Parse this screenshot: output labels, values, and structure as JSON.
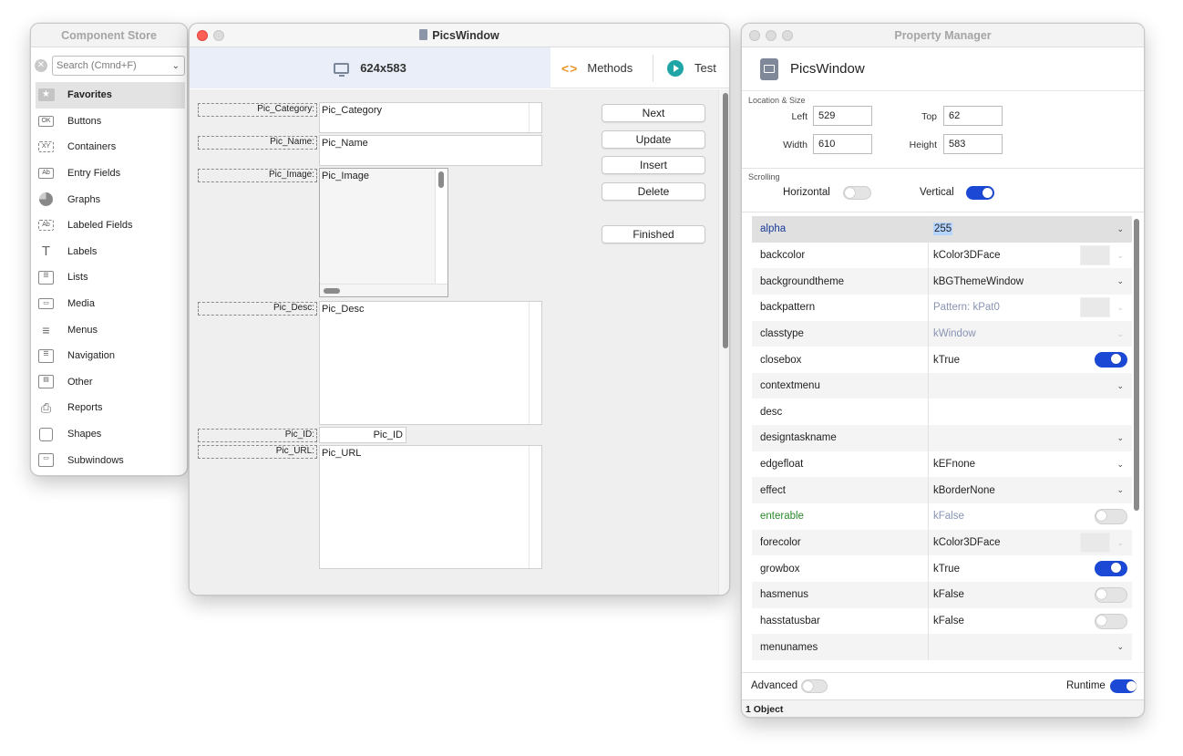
{
  "component_store": {
    "title": "Component Store",
    "search_placeholder": "Search (Cmnd+F)",
    "items": [
      {
        "label": "Favorites",
        "icon": "star-icon",
        "selected": true
      },
      {
        "label": "Buttons",
        "icon": "ok-button-icon"
      },
      {
        "label": "Containers",
        "icon": "xy-container-icon"
      },
      {
        "label": "Entry Fields",
        "icon": "entry-field-icon"
      },
      {
        "label": "Graphs",
        "icon": "pie-chart-icon"
      },
      {
        "label": "Labeled Fields",
        "icon": "labeled-field-icon"
      },
      {
        "label": "Labels",
        "icon": "text-t-icon"
      },
      {
        "label": "Lists",
        "icon": "list-icon"
      },
      {
        "label": "Media",
        "icon": "media-icon"
      },
      {
        "label": "Menus",
        "icon": "menu-icon"
      },
      {
        "label": "Navigation",
        "icon": "navigation-icon"
      },
      {
        "label": "Other",
        "icon": "other-icon"
      },
      {
        "label": "Reports",
        "icon": "printer-icon"
      },
      {
        "label": "Shapes",
        "icon": "shape-square-icon"
      },
      {
        "label": "Subwindows",
        "icon": "subwindow-icon"
      }
    ]
  },
  "pics_window": {
    "title": "PicsWindow",
    "size_label": "624x583",
    "methods_label": "Methods",
    "methods_icon": "<>",
    "test_label": "Test",
    "fields": {
      "pic_category_label": "Pic_Category:",
      "pic_category_value": "Pic_Category",
      "pic_name_label": "Pic_Name:",
      "pic_name_value": "Pic_Name",
      "pic_image_label": "Pic_Image:",
      "pic_image_value": "Pic_Image",
      "pic_desc_label": "Pic_Desc:",
      "pic_desc_value": "Pic_Desc",
      "pic_id_label": "Pic_ID:",
      "pic_id_value": "Pic_ID",
      "pic_url_label": "Pic_URL:",
      "pic_url_value": "Pic_URL"
    },
    "buttons": {
      "next": "Next",
      "update": "Update",
      "insert": "Insert",
      "delete": "Delete",
      "finished": "Finished"
    }
  },
  "property_manager": {
    "title": "Property Manager",
    "object_name": "PicsWindow",
    "location_size_label": "Location & Size",
    "left_label": "Left",
    "left_value": "529",
    "top_label": "Top",
    "top_value": "62",
    "width_label": "Width",
    "width_value": "610",
    "height_label": "Height",
    "height_value": "583",
    "scrolling_label": "Scrolling",
    "horizontal_label": "Horizontal",
    "horizontal_on": false,
    "vertical_label": "Vertical",
    "vertical_on": true,
    "properties": [
      {
        "name": "alpha",
        "value": "255",
        "control": "dropdown",
        "selected": true
      },
      {
        "name": "backcolor",
        "value": "kColor3DFace",
        "control": "color"
      },
      {
        "name": "backgroundtheme",
        "value": "kBGThemeWindow",
        "control": "dropdown"
      },
      {
        "name": "backpattern",
        "value": "Pattern: kPat0",
        "control": "color",
        "dim": true
      },
      {
        "name": "classtype",
        "value": "kWindow",
        "control": "dropdown-disabled",
        "dim": true
      },
      {
        "name": "closebox",
        "value": "kTrue",
        "control": "toggle",
        "on": true
      },
      {
        "name": "contextmenu",
        "value": "",
        "control": "dropdown"
      },
      {
        "name": "desc",
        "value": "",
        "control": "none"
      },
      {
        "name": "designtaskname",
        "value": "",
        "control": "dropdown"
      },
      {
        "name": "edgefloat",
        "value": "kEFnone",
        "control": "dropdown"
      },
      {
        "name": "effect",
        "value": "kBorderNone",
        "control": "dropdown"
      },
      {
        "name": "enterable",
        "value": "kFalse",
        "control": "toggle",
        "on": false,
        "dim": true,
        "green": true
      },
      {
        "name": "forecolor",
        "value": "kColor3DFace",
        "control": "color"
      },
      {
        "name": "growbox",
        "value": "kTrue",
        "control": "toggle",
        "on": true
      },
      {
        "name": "hasmenus",
        "value": "kFalse",
        "control": "toggle",
        "on": false
      },
      {
        "name": "hasstatusbar",
        "value": "kFalse",
        "control": "toggle",
        "on": false
      },
      {
        "name": "menunames",
        "value": "",
        "control": "dropdown"
      }
    ],
    "advanced_label": "Advanced",
    "advanced_on": false,
    "runtime_label": "Runtime",
    "runtime_on": true,
    "status": "1 Object"
  },
  "colors": {
    "accent_blue": "#1b48d4",
    "toolbar_highlight": "#e9eef8",
    "test_icon": "#1fa5a5",
    "methods_icon": "#e7982a",
    "close_light": "#ff5f57"
  }
}
